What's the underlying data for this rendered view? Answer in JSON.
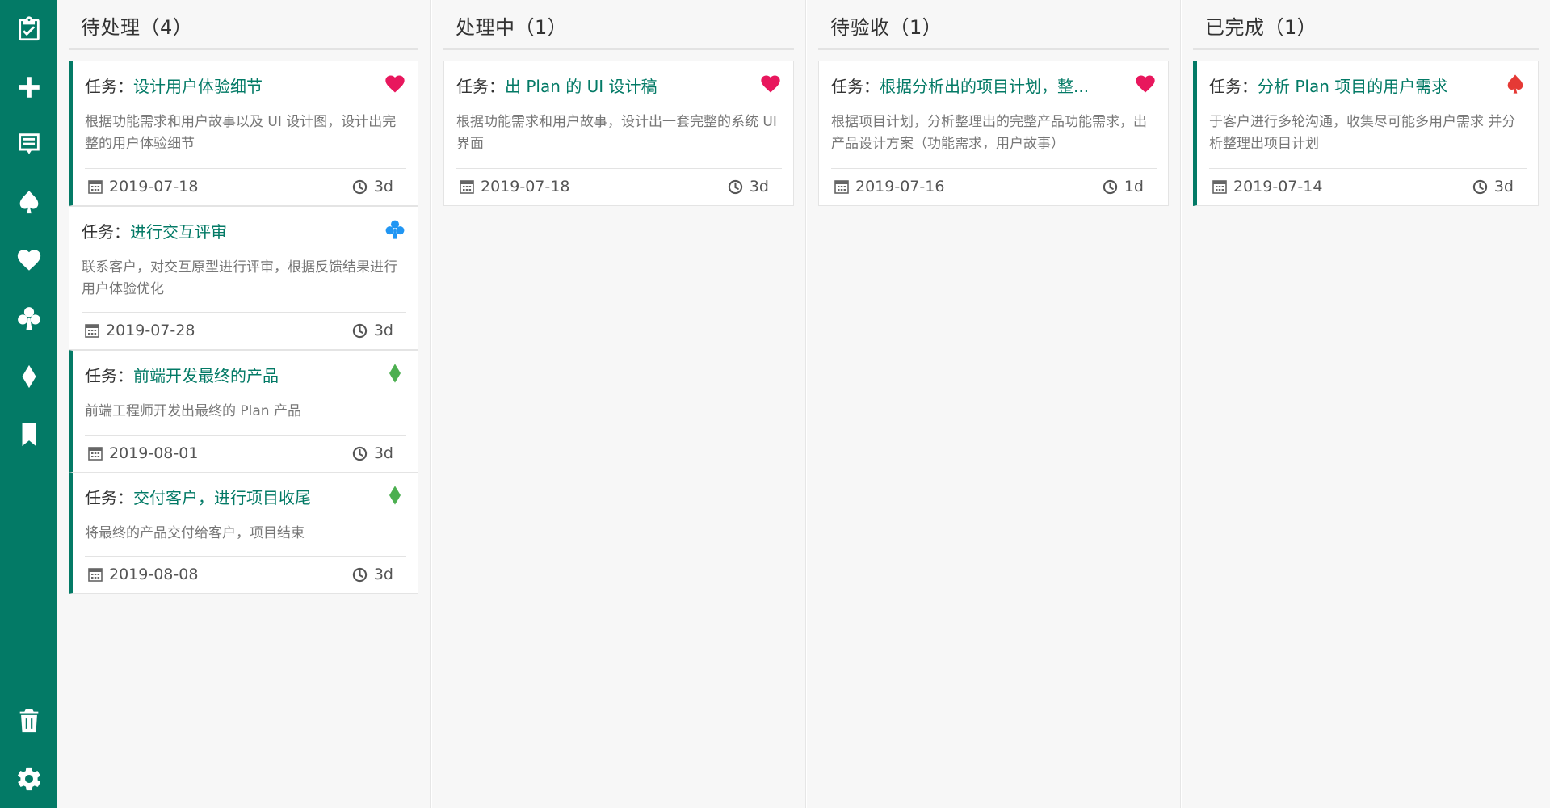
{
  "colors": {
    "accent": "#037a66",
    "heart": "#e8175d",
    "club": "#2196f3",
    "diamond": "#4caf50",
    "spade": "#e53935"
  },
  "sidebar": {
    "items": [
      {
        "icon": "clipboard-check-icon"
      },
      {
        "icon": "plus-icon"
      },
      {
        "icon": "notes-icon"
      },
      {
        "icon": "spade-icon"
      },
      {
        "icon": "heart-icon"
      },
      {
        "icon": "club-icon"
      },
      {
        "icon": "diamond-icon"
      },
      {
        "icon": "bookmark-icon"
      }
    ],
    "bottom": [
      {
        "icon": "trash-icon"
      },
      {
        "icon": "gear-icon"
      }
    ]
  },
  "columns": [
    {
      "title": "待处理（4）",
      "cards": [
        {
          "prefix": "任务：",
          "title": "设计用户体验细节",
          "desc": "根据功能需求和用户故事以及 UI 设计图，设计出完整的用户体验细节",
          "date": "2019-07-18",
          "duration": "3d",
          "suit": "heart"
        },
        {
          "prefix": "任务：",
          "title": "进行交互评审",
          "desc": "联系客户，对交互原型进行评审，根据反馈结果进行用户体验优化",
          "date": "2019-07-28",
          "duration": "3d",
          "suit": "club"
        },
        {
          "prefix": "任务：",
          "title": "前端开发最终的产品",
          "desc": "前端工程师开发出最终的 Plan 产品",
          "date": "2019-08-01",
          "duration": "3d",
          "suit": "diamond"
        },
        {
          "prefix": "任务：",
          "title": "交付客户，进行项目收尾",
          "desc": "将最终的产品交付给客户，项目结束",
          "date": "2019-08-08",
          "duration": "3d",
          "suit": "diamond"
        }
      ]
    },
    {
      "title": "处理中（1）",
      "cards": [
        {
          "prefix": "任务：",
          "title": "出 Plan 的 UI 设计稿",
          "desc": "根据功能需求和用户故事，设计出一套完整的系统 UI 界面",
          "date": "2019-07-18",
          "duration": "3d",
          "suit": "heart"
        }
      ]
    },
    {
      "title": "待验收（1）",
      "cards": [
        {
          "prefix": "任务：",
          "title": "根据分析出的项目计划，整...",
          "desc": "根据项目计划，分析整理出的完整产品功能需求，出产品设计方案（功能需求，用户故事）",
          "date": "2019-07-16",
          "duration": "1d",
          "suit": "heart"
        }
      ]
    },
    {
      "title": "已完成（1）",
      "cards": [
        {
          "prefix": "任务：",
          "title": "分析 Plan 项目的用户需求",
          "desc": "于客户进行多轮沟通，收集尽可能多用户需求 并分析整理出项目计划",
          "date": "2019-07-14",
          "duration": "3d",
          "suit": "spade"
        }
      ]
    }
  ]
}
